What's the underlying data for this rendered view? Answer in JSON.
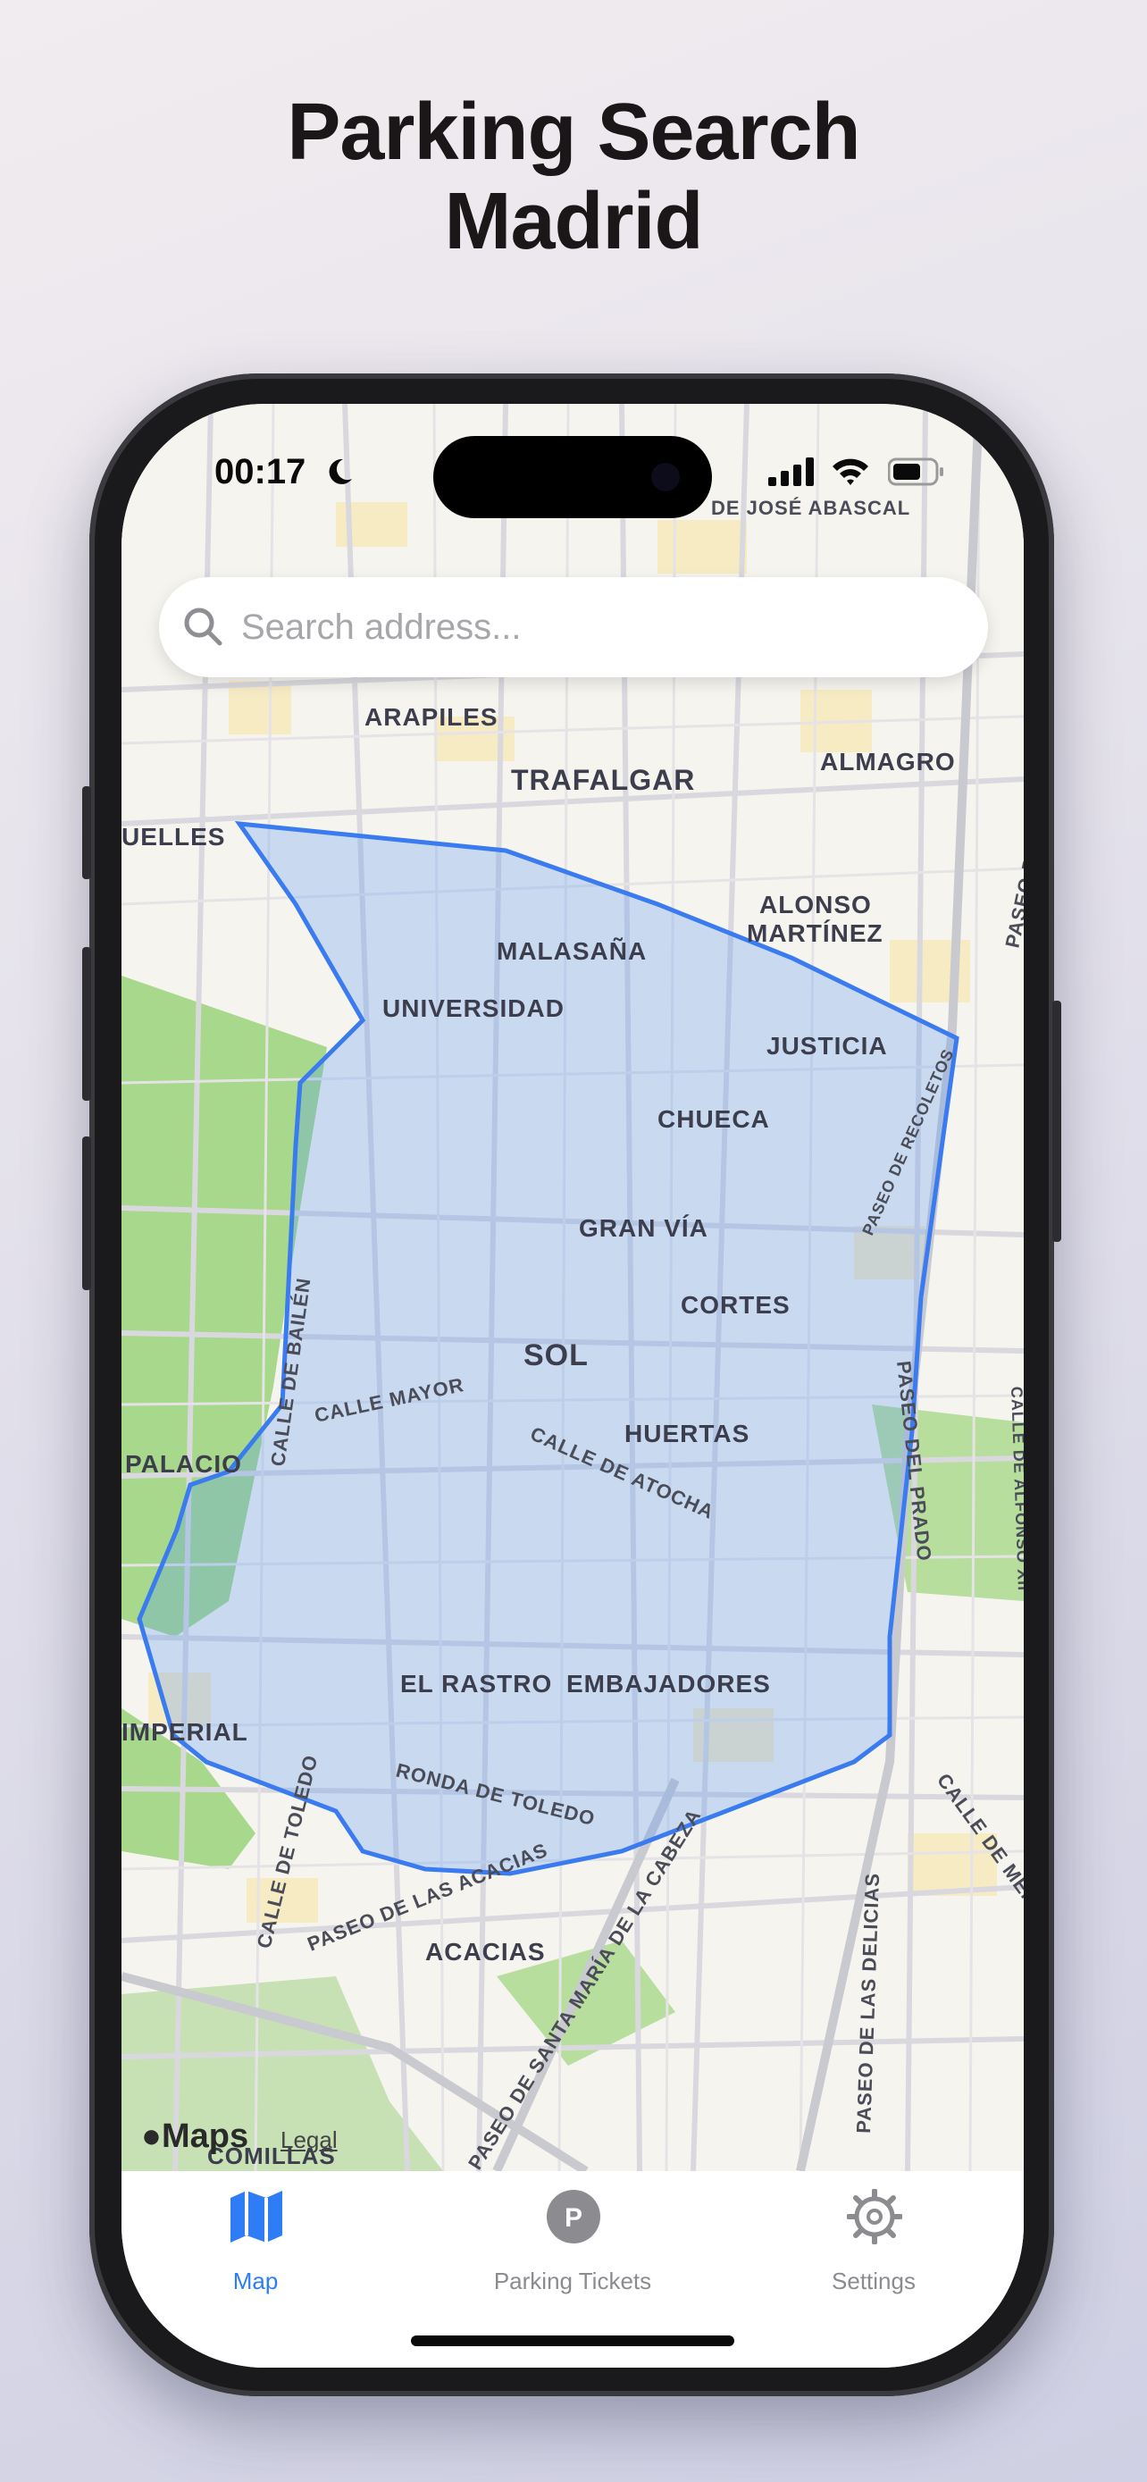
{
  "headline": {
    "line1": "Parking Search",
    "line2": "Madrid"
  },
  "status": {
    "time": "00:17"
  },
  "search": {
    "placeholder": "Search address..."
  },
  "map": {
    "neighborhoods": [
      "ARAPILES",
      "TRAFALGAR",
      "ALMAGRO",
      "MALASAÑA",
      "UNIVERSIDAD",
      "JUSTICIA",
      "CHUECA",
      "GRAN VÍA",
      "CORTES",
      "SOL",
      "HUERTAS",
      "EL RASTRO",
      "EMBAJADORES",
      "ACACIAS",
      "PALACIO",
      "IMPERIAL",
      "ALONSO",
      "MARTÍNEZ",
      "UELLES",
      "COMILLAS"
    ],
    "streets": [
      "DE JOSÉ ABASCAL",
      "CALLE MAYOR",
      "CALLE DE ATOCHA",
      "CALLE DE BAILÉN",
      "PASEO DEL PRADO",
      "PASEO DE RECOLETOS",
      "RONDA DE TOLEDO",
      "PASEO DE LAS ACACIAS",
      "CALLE DE TOLEDO",
      "PASEO DE SANTA MARÍA DE LA CABEZA",
      "PASEO DE LAS DELICIAS",
      "PASEO DE LA CASTELLANA",
      "CALLE DE ALFONSO XII",
      "CALLE DE MÉNDEZ ÁLVARO"
    ],
    "attribution": {
      "brand": "Maps",
      "legal": "Legal"
    },
    "zone_color": "#3b7bf0"
  },
  "tabs": [
    {
      "label": "Map",
      "icon": "map-icon",
      "active": true
    },
    {
      "label": "Parking Tickets",
      "icon": "parking-icon",
      "active": false
    },
    {
      "label": "Settings",
      "icon": "gear-icon",
      "active": false
    }
  ],
  "colors": {
    "accent": "#2f7df6",
    "inactive": "#8c8c90"
  }
}
